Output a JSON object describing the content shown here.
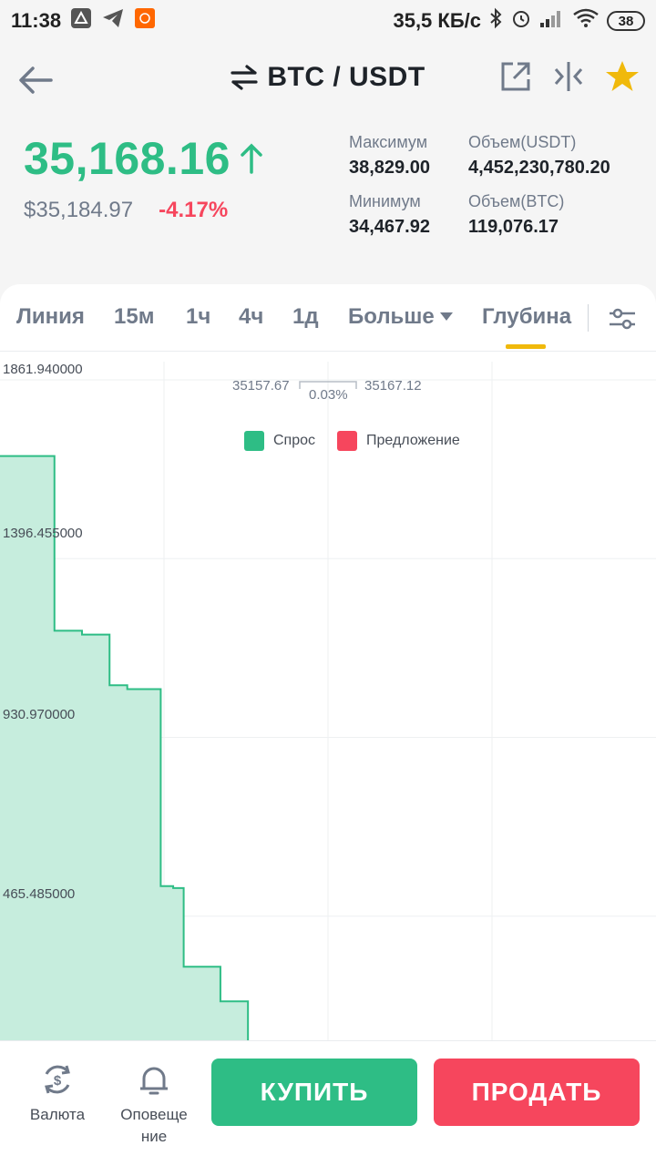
{
  "status": {
    "time": "11:38",
    "net_speed": "35,5 КБ/с",
    "battery": "38"
  },
  "header": {
    "pair": "BTC / USDT"
  },
  "ticker": {
    "last_price": "35,168.16",
    "usd_price": "$35,184.97",
    "change": "-4.17%",
    "high_label": "Максимум",
    "high_value": "38,829.00",
    "low_label": "Минимум",
    "low_value": "34,467.92",
    "vol_usdt_label": "Объем(USDT)",
    "vol_usdt_value": "4,452,230,780.20",
    "vol_btc_label": "Объем(BTC)",
    "vol_btc_value": "119,076.17"
  },
  "tabs": [
    "Линия",
    "15м",
    "1ч",
    "4ч",
    "1д",
    "Больше",
    "Глубина"
  ],
  "active_tab": "Глубина",
  "depth": {
    "spread_left": "35157.67",
    "spread_pct": "0.03%",
    "spread_right": "35167.12",
    "legend_bid": "Спрос",
    "legend_ask": "Предложение",
    "bid_color": "#2ebd85",
    "ask_color": "#f6465d"
  },
  "chart_data": {
    "type": "area",
    "y_tick_labels": [
      "1861.940000",
      "1396.455000",
      "930.970000",
      "465.485000"
    ],
    "y_ticks": [
      1861.94,
      1396.455,
      930.97,
      465.485
    ],
    "ylim": [
      0,
      1861.94
    ],
    "series": [
      {
        "name": "Спрос",
        "color": "#2ebd85",
        "steps_x": [
          0.0,
          0.052,
          0.083,
          0.125,
          0.167,
          0.194,
          0.245,
          0.264,
          0.28,
          0.336,
          0.378,
          0.406,
          0.435
        ],
        "steps_y": [
          1640,
          1640,
          1185,
          1175,
          1043,
          1033,
          520,
          515,
          310,
          220,
          115,
          105,
          0
        ]
      },
      {
        "name": "Предложение",
        "color": "#f6465d",
        "steps_x": [
          0.903,
          1.0
        ],
        "steps_y": [
          45,
          45
        ]
      }
    ]
  },
  "bottom": {
    "currency_label": "Валюта",
    "alerts_label": "Оповеще ние",
    "buy_label": "КУПИТЬ",
    "sell_label": "ПРОДАТЬ"
  }
}
